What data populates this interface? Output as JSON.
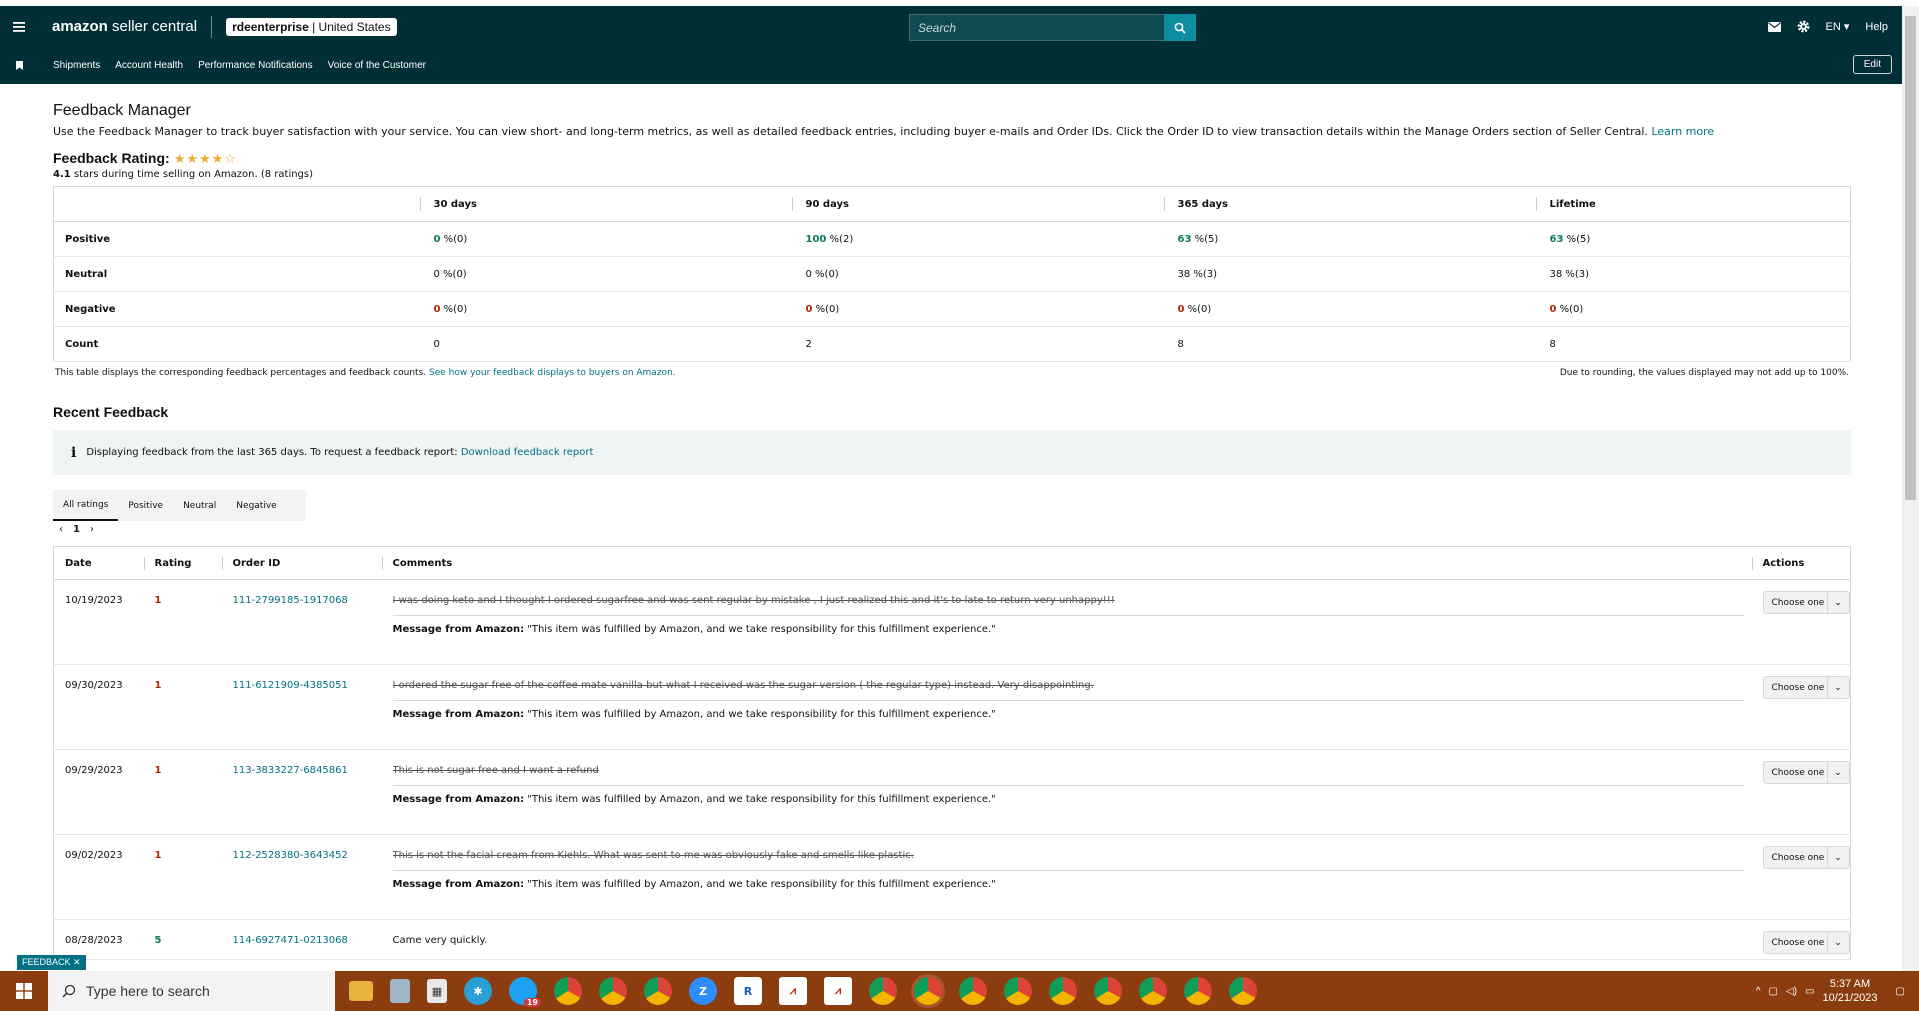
{
  "header": {
    "logo_prefix": "amazon",
    "logo_suffix": " seller central",
    "account_store": "rdeenterprise",
    "account_region": " | United States",
    "search_placeholder": "Search",
    "language": "EN",
    "help": "Help"
  },
  "nav": {
    "links": [
      "Shipments",
      "Account Health",
      "Performance Notifications",
      "Voice of the Customer"
    ],
    "edit": "Edit"
  },
  "page": {
    "title": "Feedback Manager",
    "intro": "Use the Feedback Manager to track buyer satisfaction with your service. You can view short- and long-term metrics, as well as detailed feedback entries, including buyer e-mails and Order IDs. Click the Order ID to view transaction details within the Manage Orders section of Seller Central.",
    "learn_more": "Learn more",
    "rating_label": "Feedback Rating:",
    "rating_value": 4.1,
    "rating_value_text": "4.1",
    "rating_summary": " stars during time selling on Amazon. (8 ratings)"
  },
  "metrics": {
    "columns": [
      "30 days",
      "90 days",
      "365 days",
      "Lifetime"
    ],
    "rows": [
      {
        "label": "Positive",
        "cells": [
          [
            "0",
            " %(0)"
          ],
          [
            "100",
            " %(2)"
          ],
          [
            "63",
            " %(5)"
          ],
          [
            "63",
            " %(5)"
          ]
        ]
      },
      {
        "label": "Neutral",
        "cells": [
          [
            "",
            "0 %(0)"
          ],
          [
            "",
            "0 %(0)"
          ],
          [
            "",
            "38 %(3)"
          ],
          [
            "",
            "38 %(3)"
          ]
        ]
      },
      {
        "label": "Negative",
        "cells": [
          [
            "0",
            " %(0)"
          ],
          [
            "0",
            " %(0)"
          ],
          [
            "0",
            " %(0)"
          ],
          [
            "0",
            " %(0)"
          ]
        ]
      },
      {
        "label": "Count",
        "cells": [
          [
            "",
            "0"
          ],
          [
            "",
            "2"
          ],
          [
            "",
            "8"
          ],
          [
            "",
            "8"
          ]
        ]
      }
    ],
    "footnote_left": "This table displays the corresponding feedback percentages and feedback counts.",
    "footnote_link": "See how your feedback displays to buyers on Amazon.",
    "footnote_right": "Due to rounding, the values displayed may not add up to 100%."
  },
  "recent": {
    "title": "Recent Feedback",
    "info_icon": "i",
    "info_text": "Displaying feedback from the last 365 days. To request a feedback report:",
    "info_link": "Download feedback report",
    "tabs": [
      "All ratings",
      "Positive",
      "Neutral",
      "Negative"
    ],
    "page": "1",
    "columns": [
      "Date",
      "Rating",
      "Order ID",
      "Comments",
      "Actions"
    ],
    "msg_label": "Message from Amazon:",
    "msg_text": " \"This item was fulfilled by Amazon, and we take responsibility for this fulfillment experience.\"",
    "action_label": "Choose one",
    "rows": [
      {
        "date": "10/19/2023",
        "rating": "1",
        "order": "111-2799185-1917068",
        "comment": "I was doing keto and I thought I ordered sugarfree and was sent regular by mistake , I just realized this and it's to late to return very unhappy!!!"
      },
      {
        "date": "09/30/2023",
        "rating": "1",
        "order": "111-6121909-4385051",
        "comment": "I ordered the sugar free of the coffee mate vanilla but what I received was the sugar version ( the regular type) instead. Very disappointing."
      },
      {
        "date": "09/29/2023",
        "rating": "1",
        "order": "113-3833227-6845861",
        "comment": "This is not sugar free and I want a refund"
      },
      {
        "date": "09/02/2023",
        "rating": "1",
        "order": "112-2528380-3643452",
        "comment": "This is not the facial cream from Kiehls. What was sent to me was obviously fake and smells like plastic."
      },
      {
        "date": "08/28/2023",
        "rating": "5",
        "order": "114-6927471-0213068",
        "comment": "Came very quickly."
      }
    ]
  },
  "feedback_tab": "FEEDBACK ✕",
  "taskbar": {
    "search_placeholder": "Type here to search",
    "time": "5:37 AM",
    "date": "10/21/2023",
    "badge": "19"
  },
  "colors": {
    "header_bg": "#002f36",
    "link": "#007185",
    "positive": "#067d62",
    "negative": "#b12704",
    "taskbar": "#8b3d0f"
  }
}
